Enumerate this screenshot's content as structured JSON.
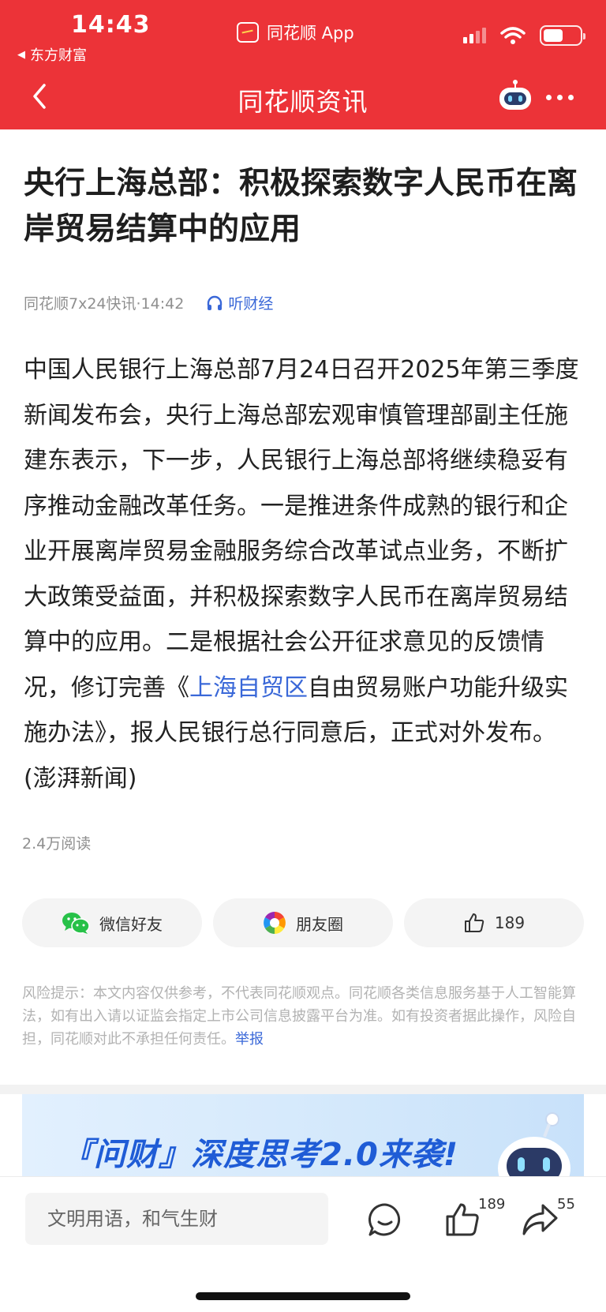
{
  "status_bar": {
    "time": "14:43",
    "back_app": "东方财富",
    "app_indicator": "同花顺 App"
  },
  "nav": {
    "title": "同花顺资讯"
  },
  "article": {
    "title": "央行上海总部：积极探索数字人民币在离岸贸易结算中的应用",
    "source": "同花顺7x24快讯·14:42",
    "listen_label": "听财经",
    "body_part1": "中国人民银行上海总部7月24日召开2025年第三季度新闻发布会，央行上海总部宏观审慎管理部副主任施建东表示，下一步，人民银行上海总部将继续稳妥有序推动金融改革任务。一是推进条件成熟的银行和企业开展离岸贸易金融服务综合改革试点业务，不断扩大政策受益面，并积极探索数字人民币在离岸贸易结算中的应用。二是根据社会公开征求意见的反馈情况，修订完善《",
    "body_link": "上海自贸区",
    "body_part2": "自由贸易账户功能升级实施办法》，报人民银行总行同意后，正式对外发布。(澎湃新闻)",
    "reads": "2.4万阅读"
  },
  "share": {
    "wechat_label": "微信好友",
    "moments_label": "朋友圈",
    "like_count": "189"
  },
  "disclaimer": {
    "text": "风险提示：本文内容仅供参考，不代表同花顺观点。同花顺各类信息服务基于人工智能算法，如有出入请以证监会指定上市公司信息披露平台为准。如有投资者据此操作，风险自担，同花顺对此不承担任何责任。",
    "report_label": "举报"
  },
  "banner": {
    "text": "『问财』深度思考2.0来袭!"
  },
  "bottom_bar": {
    "comment_placeholder": "文明用语，和气生财",
    "like_count": "189",
    "share_count": "55"
  },
  "colors": {
    "brand_red": "#ec3338",
    "link_blue": "#3a68d8",
    "wechat_green": "#27c148"
  },
  "icons": [
    "back-chevron-icon",
    "robot-icon",
    "more-icon",
    "headphones-icon",
    "wechat-icon",
    "moments-icon",
    "thumbs-up-icon",
    "comment-icon",
    "share-icon"
  ]
}
